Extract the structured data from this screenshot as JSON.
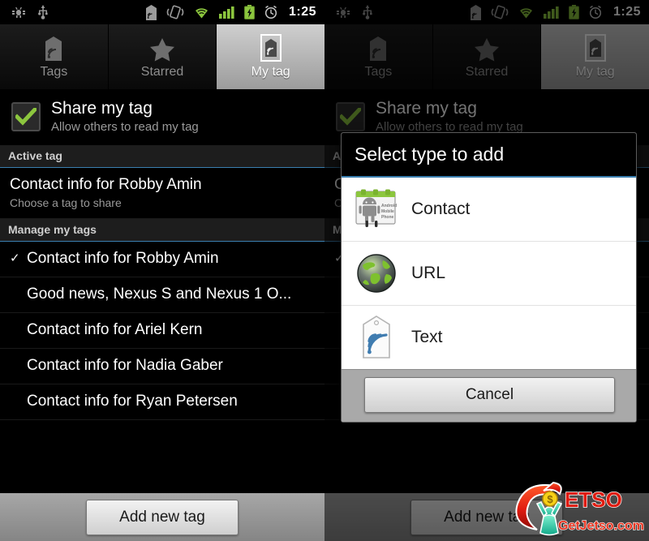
{
  "statusbar": {
    "time": "1:25",
    "icons_left": [
      "android-debug-icon",
      "usb-icon"
    ],
    "icons_right": [
      "nfc-tag-icon",
      "vibrate-icon",
      "wifi-icon",
      "signal-icon",
      "battery-charging-icon",
      "alarm-icon"
    ],
    "accent_green": "#8cc63e"
  },
  "tabs": [
    {
      "label": "Tags",
      "icon": "tag-icon",
      "selected": false
    },
    {
      "label": "Starred",
      "icon": "star-icon",
      "selected": false
    },
    {
      "label": "My tag",
      "icon": "my-tag-icon",
      "selected": true
    }
  ],
  "share": {
    "title": "Share my tag",
    "subtitle": "Allow others to read my tag",
    "checked": true,
    "check_color": "#8cc63e"
  },
  "sections": [
    {
      "header": "Active tag"
    },
    {
      "header": "Manage my tags"
    }
  ],
  "active_tag": {
    "title": "Contact info for Robby Amin",
    "subtitle": "Choose a tag to share"
  },
  "manage_tags": [
    {
      "title": "Contact info for Robby Amin",
      "checked": true
    },
    {
      "title": "Good news, Nexus S and Nexus 1 O...",
      "checked": false
    },
    {
      "title": "Contact info for Ariel Kern",
      "checked": false
    },
    {
      "title": "Contact info for Nadia Gaber",
      "checked": false
    },
    {
      "title": "Contact info for Ryan Petersen",
      "checked": false
    }
  ],
  "bottom": {
    "add_new_tag": "Add new tag"
  },
  "dialog": {
    "title": "Select type to add",
    "items": [
      {
        "label": "Contact",
        "icon": "contact-card-icon",
        "card_text": [
          "Android",
          "Mobile",
          "Phone"
        ]
      },
      {
        "label": "URL",
        "icon": "globe-icon"
      },
      {
        "label": "Text",
        "icon": "nfc-tag-icon"
      }
    ],
    "cancel": "Cancel"
  },
  "watermark": {
    "text_main": "ETSO",
    "text_sub": "GetJetso.com",
    "coin": "$"
  },
  "tick_glyph": "✓"
}
